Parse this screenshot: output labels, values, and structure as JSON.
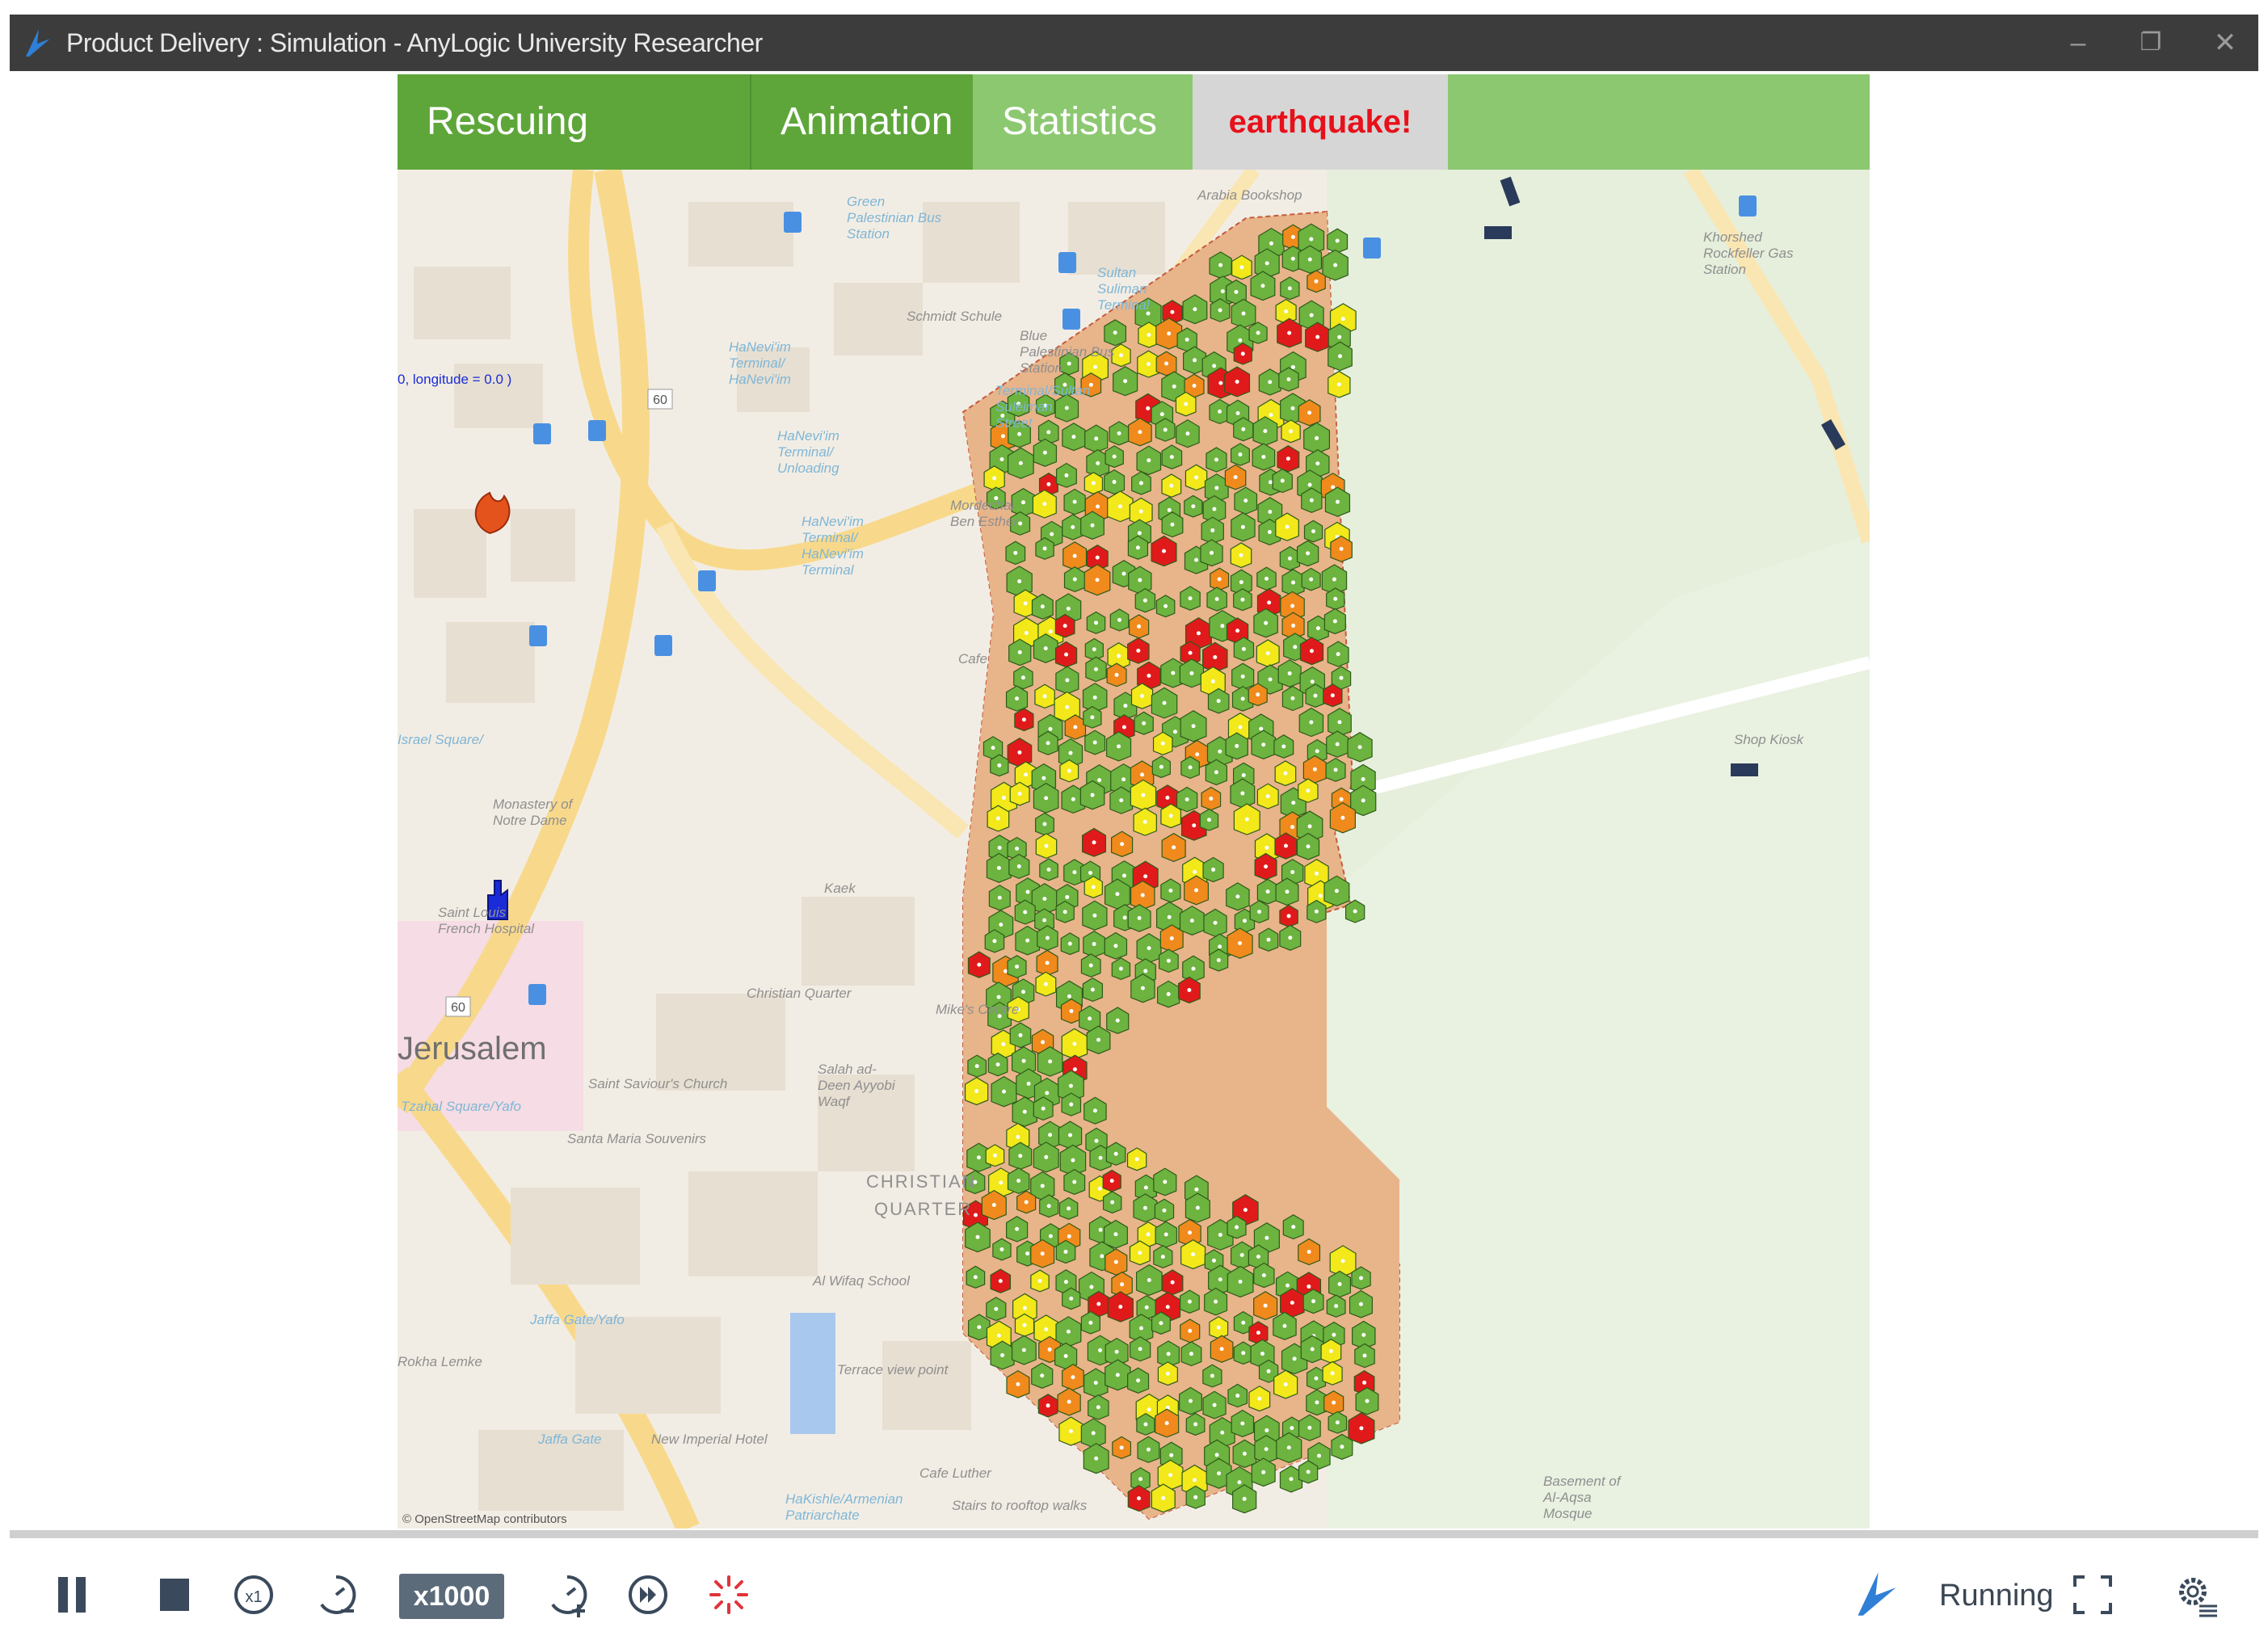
{
  "window": {
    "title": "Product Delivery : Simulation - AnyLogic University Researcher",
    "minimize_glyph": "–",
    "restore_glyph": "❐",
    "close_glyph": "✕"
  },
  "tabs": [
    {
      "label": "Rescuing"
    },
    {
      "label": "Animation"
    },
    {
      "label": "Statistics"
    },
    {
      "label": "earthquake!"
    }
  ],
  "map": {
    "city_label": "Jerusalem",
    "district_label_1": "CHRISTIAN",
    "district_label_2": "QUARTER",
    "coord_readout": "0, longitude = 0.0 )",
    "attribution": "© OpenStreetMap contributors",
    "road_number_1": "60",
    "road_number_2": "60",
    "places": [
      "Green Palestinian Bus Station",
      "Arabia Bookshop",
      "Khorshed Rockfeller Gas Station",
      "Sultan Suliman Terminal",
      "Schmidt Schule",
      "Blue Palestinian Bus Station",
      "Terminal/Sultan Suleiman Street",
      "HaNevi'im Terminal/ HaNevi'im",
      "HaNevi'im Terminal/ Unloading",
      "HaNevi'im Terminal/ HaNevi'im Terminal",
      "Mordechai Ben Esther",
      "Monastery of Notre Dame",
      "Saint Louis French Hospital",
      "Christian Quarter",
      "Salah ad-Deen Ayyobi Waqf",
      "Saint Saviour's Church",
      "Santa Maria Souvenirs",
      "Al Wifaq School",
      "Terrace view point",
      "New Imperial Hotel",
      "Jaffa Gate",
      "Cafe Luther",
      "Stairs to rooftop walks",
      "HaKishle/Armenian Patriarchate",
      "Basement of Al-Aqsa Mosque",
      "Shop Kiosk",
      "Mike's Centre",
      "Kaek",
      "Jaffa Gate/Yafo",
      "Tzahal Square/Yafo",
      "Israel Square/",
      "Rokha Lemke",
      "Cafe"
    ]
  },
  "controls": {
    "speed": "x1000",
    "status": "Running"
  },
  "colors": {
    "titlebar": "#3c3c3c",
    "tab_active": "#5ea63a",
    "tab_inactive": "#8cc870",
    "earthquake_text": "#e8101a",
    "building_ok": "#6db33f",
    "building_light": "#f2e81a",
    "building_medium": "#f08a1c",
    "building_severe": "#e01a1a",
    "zone_fill": "#e8b48a"
  }
}
